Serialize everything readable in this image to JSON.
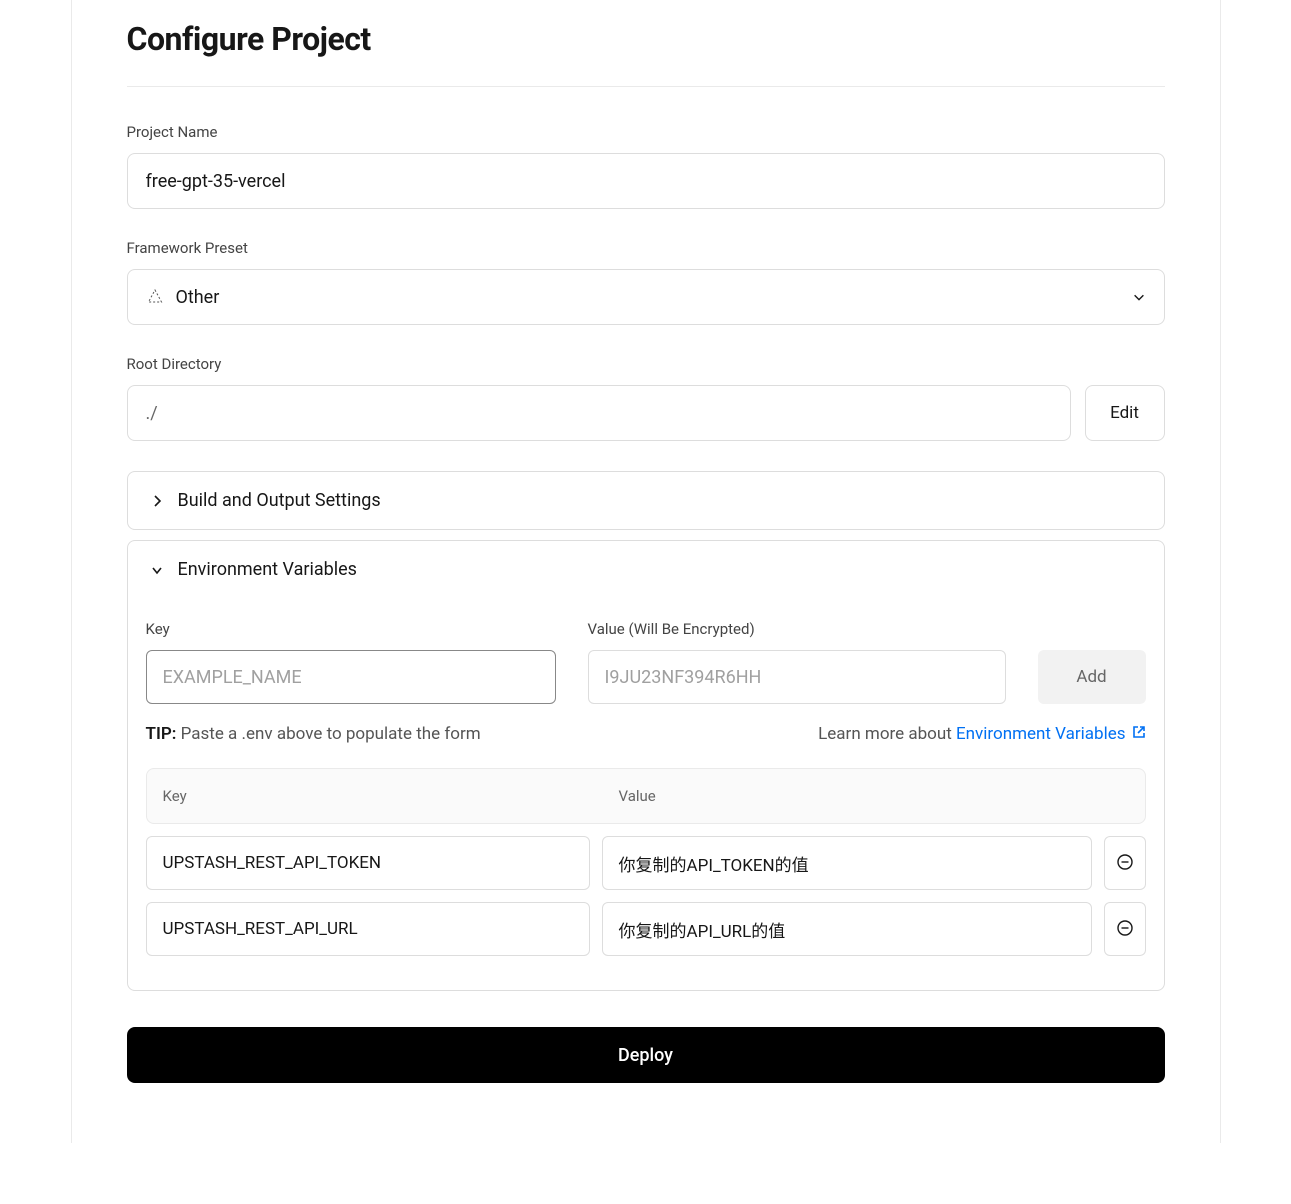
{
  "page_title": "Configure Project",
  "project_name": {
    "label": "Project Name",
    "value": "free-gpt-35-vercel"
  },
  "framework_preset": {
    "label": "Framework Preset",
    "selected": "Other"
  },
  "root_directory": {
    "label": "Root Directory",
    "value": "./",
    "edit_label": "Edit"
  },
  "build_settings": {
    "header": "Build and Output Settings"
  },
  "env_vars_section": {
    "header": "Environment Variables",
    "key_label": "Key",
    "value_label": "Value (Will Be Encrypted)",
    "key_placeholder": "EXAMPLE_NAME",
    "value_placeholder": "I9JU23NF394R6HH",
    "add_label": "Add",
    "tip_label": "TIP:",
    "tip_text": " Paste a .env above to populate the form",
    "learn_prefix": "Learn more about ",
    "learn_link": "Environment Variables",
    "table_key_header": "Key",
    "table_value_header": "Value",
    "rows": [
      {
        "key": "UPSTASH_REST_API_TOKEN",
        "value": "你复制的API_TOKEN的值"
      },
      {
        "key": "UPSTASH_REST_API_URL",
        "value": "你复制的API_URL的值"
      }
    ]
  },
  "deploy_label": "Deploy"
}
